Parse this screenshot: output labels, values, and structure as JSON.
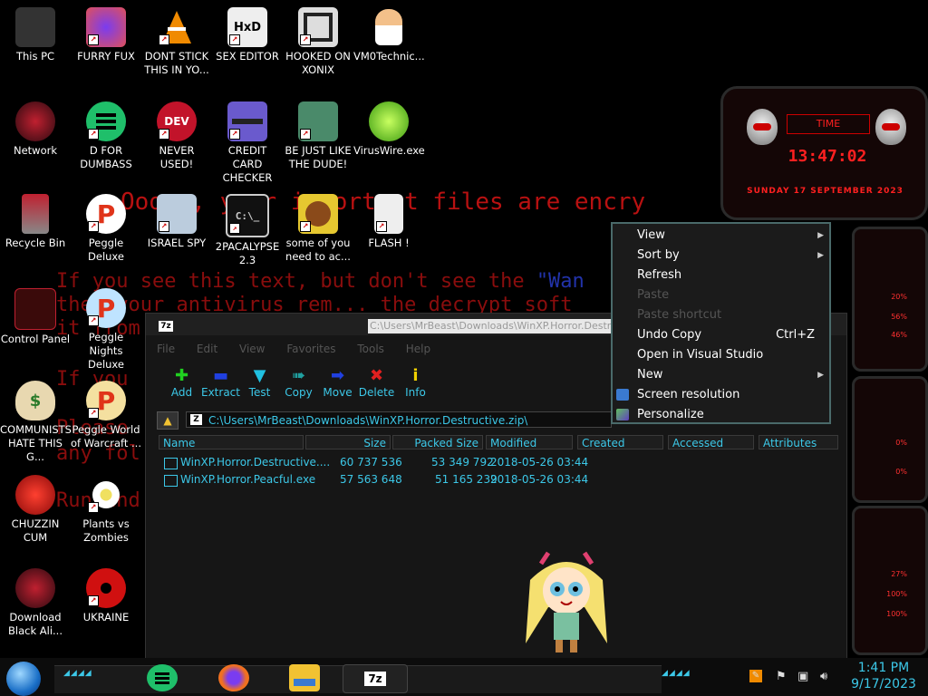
{
  "ransom": {
    "line1": "Ooops, your important files are encry",
    "line2": "If you see this text, but don't see the ",
    "line2b": "\"Wan",
    "line3": "then your antivirus rem...  the decrypt soft",
    "line4": "it from",
    "line5": "If you",
    "line6": "Please",
    "line7": "any fol",
    "line8": "Run and"
  },
  "desktop_icons": [
    {
      "label": "This PC"
    },
    {
      "label": "FURRY FUX"
    },
    {
      "label": "DONT STICK THIS IN YO..."
    },
    {
      "label": "SEX EDITOR"
    },
    {
      "label": "HOOKED ON XONIX"
    },
    {
      "label": "VM0Technic..."
    },
    {
      "label": "Network"
    },
    {
      "label": "D FOR DUMBASS"
    },
    {
      "label": "NEVER USED!"
    },
    {
      "label": "CREDIT CARD CHECKER"
    },
    {
      "label": "BE JUST LIKE THE DUDE!"
    },
    {
      "label": "VirusWire.exe"
    },
    {
      "label": "Recycle Bin"
    },
    {
      "label": "Peggle Deluxe"
    },
    {
      "label": "ISRAEL SPY"
    },
    {
      "label": "2PACALYPSE 2.3"
    },
    {
      "label": "some of you need to ac..."
    },
    {
      "label": "FLASH !"
    },
    {
      "label": "Control Panel"
    },
    {
      "label": "Peggle Nights Deluxe"
    },
    {
      "label": "COMMUNISTS HATE THIS G..."
    },
    {
      "label": "Peggle World of Warcraft ..."
    },
    {
      "label": "CHUZZIN CUM"
    },
    {
      "label": "Plants vs Zombies"
    },
    {
      "label": "Download Black Ali..."
    },
    {
      "label": "UKRAINE"
    }
  ],
  "gadget": {
    "time_label": "TIME",
    "time": "13:47:02",
    "date": "SUNDAY 17 SEPTEMBER 2023",
    "panel_values": [
      "20%",
      "56%",
      "46%",
      "0%",
      "0%",
      "27%",
      "100%",
      "100%"
    ]
  },
  "window": {
    "title_icon": "7z",
    "title": "C:\\Users\\MrBeast\\Downloads\\WinXP.Horror.Destructive.zip\\",
    "menu": [
      "File",
      "Edit",
      "View",
      "Favorites",
      "Tools",
      "Help"
    ],
    "toolbar": [
      {
        "label": "Add",
        "icon": "plus-icon"
      },
      {
        "label": "Extract",
        "icon": "minus-icon"
      },
      {
        "label": "Test",
        "icon": "check-icon"
      },
      {
        "label": "Copy",
        "icon": "double-arrow-icon"
      },
      {
        "label": "Move",
        "icon": "arrow-icon"
      },
      {
        "label": "Delete",
        "icon": "x-icon"
      },
      {
        "label": "Info",
        "icon": "info-icon"
      }
    ],
    "address": "C:\\Users\\MrBeast\\Downloads\\WinXP.Horror.Destructive.zip\\",
    "columns": [
      "Name",
      "Size",
      "Packed Size",
      "Modified",
      "Created",
      "Accessed",
      "Attributes"
    ],
    "rows": [
      {
        "name": "WinXP.Horror.Destructive....",
        "size": "60 737 536",
        "packed": "53 349 792",
        "modified": "2018-05-26 03:44"
      },
      {
        "name": "WinXP.Horror.Peacful.exe",
        "size": "57 563 648",
        "packed": "51 165 239",
        "modified": "2018-05-26 03:44"
      }
    ]
  },
  "context_menu": [
    {
      "label": "View",
      "submenu": true,
      "disabled": false
    },
    {
      "label": "Sort by",
      "submenu": true,
      "disabled": false
    },
    {
      "label": "Refresh",
      "disabled": false
    },
    {
      "label": "Paste",
      "disabled": true
    },
    {
      "label": "Paste shortcut",
      "disabled": true
    },
    {
      "label": "Undo Copy",
      "shortcut": "Ctrl+Z",
      "disabled": false
    },
    {
      "label": "Open in Visual Studio",
      "disabled": false
    },
    {
      "label": "New",
      "submenu": true,
      "disabled": false
    },
    {
      "label": "Screen resolution",
      "disabled": false,
      "icon": "monitor-icon"
    },
    {
      "label": "Personalize",
      "disabled": false,
      "icon": "personalize-icon"
    }
  ],
  "taskbar": {
    "apps": [
      "Drive",
      "Firefox",
      "File Explorer",
      "7z"
    ],
    "clock_time": "1:41 PM",
    "clock_date": "9/17/2023"
  },
  "colors": {
    "accent": "#3cc8e8",
    "ransom_red": "#b81111",
    "alert_red": "#ff2020"
  }
}
